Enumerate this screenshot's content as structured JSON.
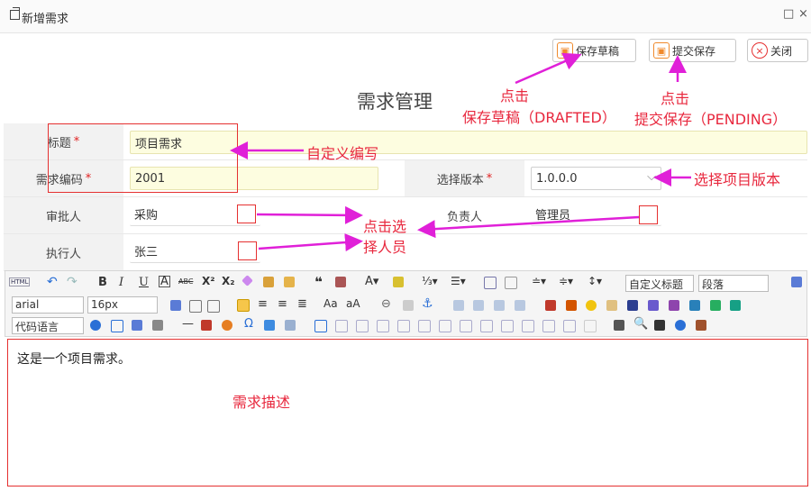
{
  "window": {
    "title": "新增需求",
    "max_icon": "□",
    "close_icon": "×"
  },
  "buttons": {
    "draft": "保存草稿",
    "submit": "提交保存",
    "close": "关闭"
  },
  "form": {
    "heading": "需求管理",
    "title_label": "标题",
    "title_value": "项目需求",
    "code_label": "需求编码",
    "code_value": "2001",
    "version_label": "选择版本",
    "version_value": "1.0.0.0",
    "approver_label": "审批人",
    "approver_value": "采购",
    "owner_label": "负责人",
    "owner_value": "管理员",
    "executor_label": "执行人",
    "executor_value": "张三",
    "required_mark": "*"
  },
  "toolbar": {
    "font_family": "arial",
    "font_size": "16px",
    "custom_title": "自定义标题",
    "paragraph": "段落",
    "code_language": "代码语言",
    "html_btn": "HTML"
  },
  "editor": {
    "content": "这是一个项目需求。"
  },
  "annotations": {
    "draft_line1": "点击",
    "draft_line2": "保存草稿（DRAFTED）",
    "submit_line1": "点击",
    "submit_line2": "提交保存（PENDING）",
    "custom_title": "自定义编写",
    "select_version": "选择项目版本",
    "select_person_1": "点击选",
    "select_person_2": "择人员",
    "description": "需求描述"
  },
  "colors": {
    "annotation": "#e8283e",
    "arrow": "#e020d8"
  }
}
